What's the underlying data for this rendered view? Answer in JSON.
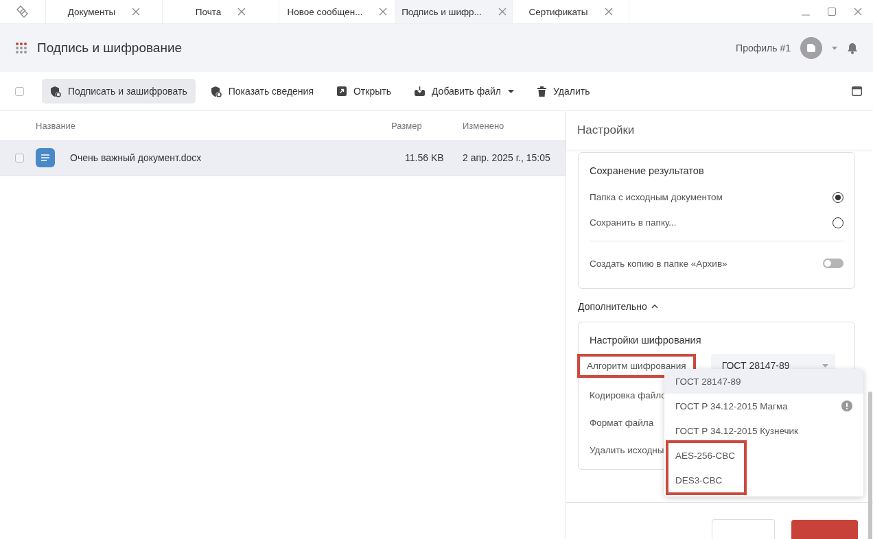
{
  "tabs": [
    {
      "label": "Документы",
      "selected": false
    },
    {
      "label": "Почта",
      "selected": false
    },
    {
      "label": "Новое сообщен...",
      "selected": false
    },
    {
      "label": "Подпись и шифр...",
      "selected": true
    },
    {
      "label": "Сертификаты",
      "selected": false
    }
  ],
  "header": {
    "title": "Подпись и шифрование",
    "profile": "Профиль #1"
  },
  "toolbar": {
    "select_all_checked": false,
    "buttons": [
      {
        "label": "Подписать и зашифровать",
        "selected": true,
        "kind": "shield",
        "has_menu": false
      },
      {
        "label": "Показать сведения",
        "selected": false,
        "kind": "shield",
        "has_menu": false
      },
      {
        "label": "Открыть",
        "selected": false,
        "kind": "open",
        "has_menu": false
      },
      {
        "label": "Добавить файл",
        "selected": false,
        "kind": "add",
        "has_menu": true
      },
      {
        "label": "Удалить",
        "selected": false,
        "kind": "trash",
        "has_menu": false
      }
    ]
  },
  "table": {
    "columns": [
      "Название",
      "Размер",
      "Изменено"
    ],
    "rows": [
      {
        "name": "Очень важный документ.docx",
        "size": "11.56 KB",
        "modified": "2 апр. 2025 г., 15:05",
        "selected": true,
        "checked": false
      }
    ]
  },
  "settings": {
    "title": "Настройки",
    "save_results": {
      "title": "Сохранение результатов",
      "options": [
        {
          "label": "Папка с исходным документом",
          "selected": true
        },
        {
          "label": "Сохранить в папку...",
          "selected": false
        }
      ],
      "toggle": {
        "label": "Создать копию в папке «Архив»",
        "on": false
      }
    },
    "advanced": {
      "label": "Дополнительно",
      "expanded": true
    },
    "encryption": {
      "title": "Настройки шифрования",
      "fields": [
        {
          "label": "Алгоритм шифрования",
          "kind": "select",
          "value": "ГОСТ 28147-89",
          "highlighted": true
        },
        {
          "label": "Кодировка файло",
          "kind": "plain",
          "highlighted": false
        },
        {
          "label": "Формат файла",
          "kind": "plain",
          "highlighted": false
        },
        {
          "label": "Удалить исходны",
          "kind": "plain",
          "highlighted": false
        }
      ]
    },
    "dropdown": [
      {
        "label": "ГОСТ 28147-89",
        "selected": true,
        "warning": false,
        "highlighted": false
      },
      {
        "label": "ГОСТ Р 34.12-2015 Магма",
        "selected": false,
        "warning": true,
        "highlighted": false
      },
      {
        "label": "ГОСТ Р 34.12-2015 Кузнечик",
        "selected": false,
        "warning": false,
        "highlighted": false
      },
      {
        "label": "AES-256-CBC",
        "selected": false,
        "warning": false,
        "highlighted": true
      },
      {
        "label": "DES3-CBC",
        "selected": false,
        "warning": false,
        "highlighted": true
      }
    ]
  }
}
